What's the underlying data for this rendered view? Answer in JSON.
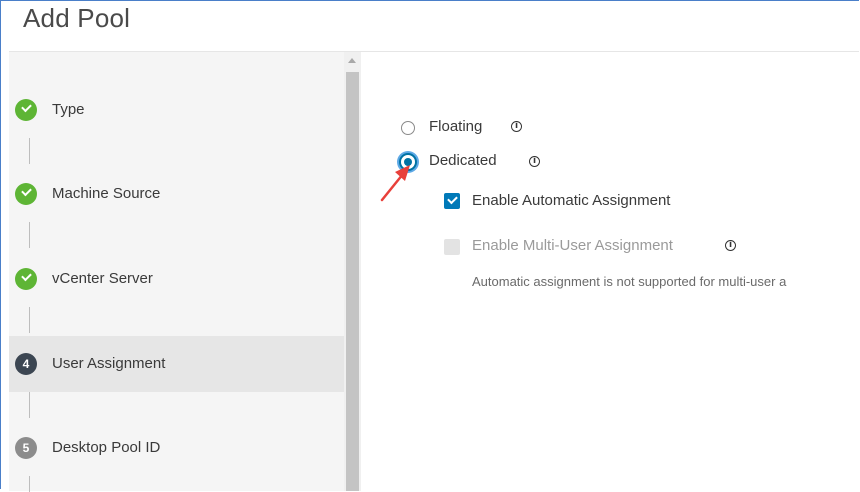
{
  "dialog": {
    "title": "Add Pool"
  },
  "steps": [
    {
      "number": "",
      "label": "Type",
      "state": "done"
    },
    {
      "number": "",
      "label": "Machine Source",
      "state": "done"
    },
    {
      "number": "",
      "label": "vCenter Server",
      "state": "done"
    },
    {
      "number": "4",
      "label": "User Assignment",
      "state": "current"
    },
    {
      "number": "5",
      "label": "Desktop Pool ID",
      "state": "pending"
    }
  ],
  "assignment": {
    "floating_label": "Floating",
    "dedicated_label": "Dedicated",
    "selected": "Dedicated",
    "auto_assign_label": "Enable Automatic Assignment",
    "auto_assign_checked": true,
    "multi_user_label": "Enable Multi-User Assignment",
    "multi_user_checked": false,
    "multi_user_note": "Automatic assignment is not supported for multi-user a"
  },
  "icons": {
    "info": "i"
  },
  "colors": {
    "accent": "#0072a3",
    "done": "#5eb535",
    "current": "#3c4652",
    "pending": "#8c8c8c",
    "annotation_arrow": "#e8403a"
  }
}
